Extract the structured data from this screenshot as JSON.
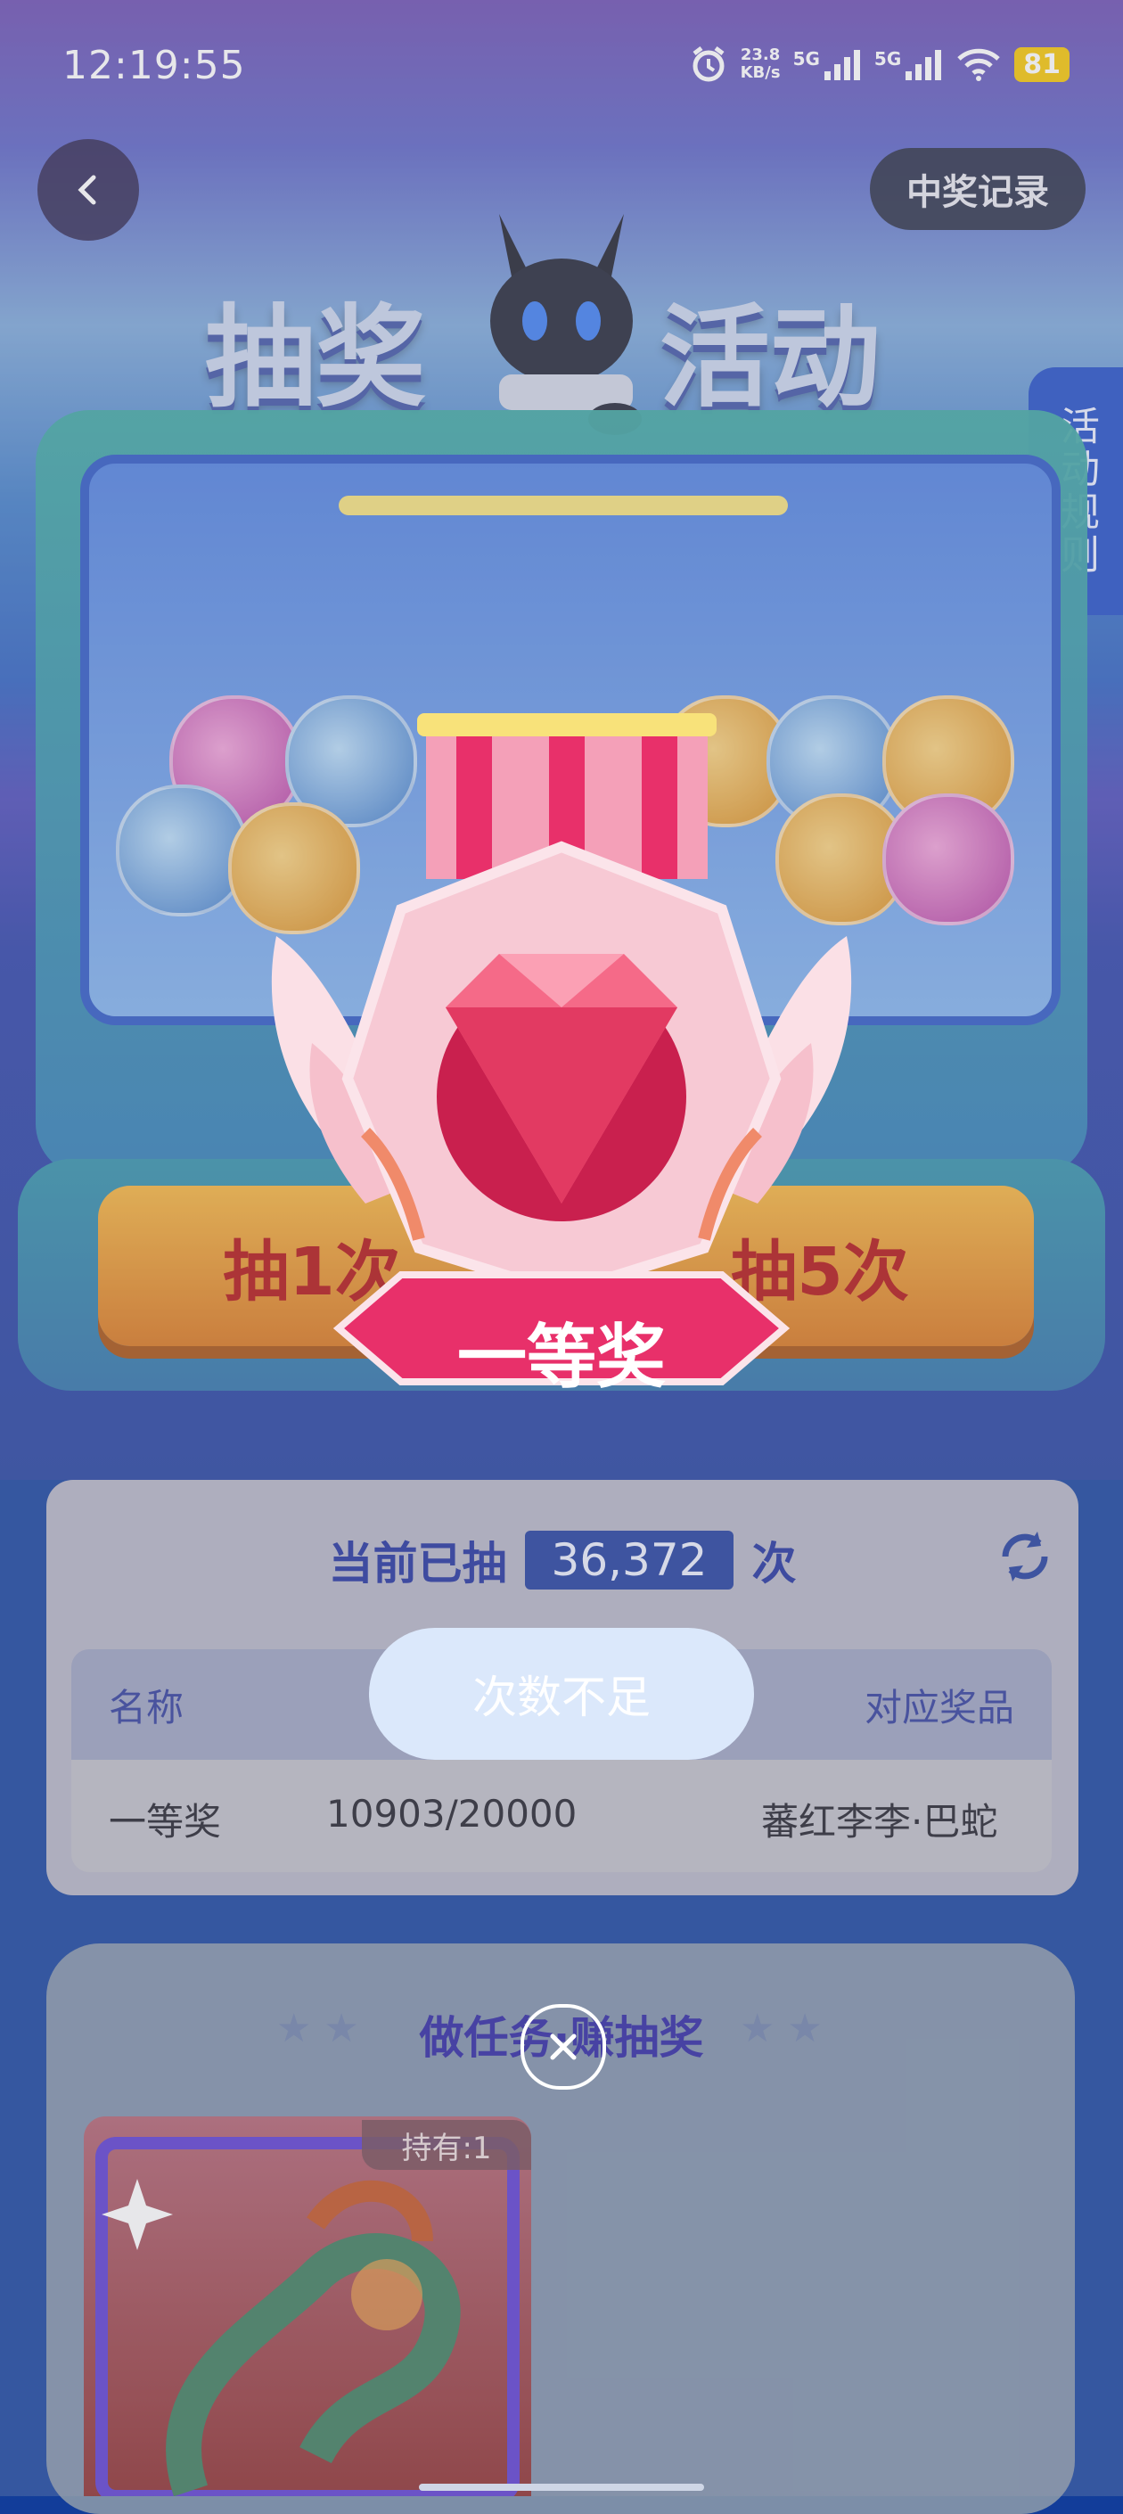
{
  "status_bar": {
    "time": "12:19:55",
    "net_speed": "23.8",
    "net_unit": "KB/s",
    "signal1": "5G",
    "signal2": "5G",
    "battery": "81"
  },
  "header": {
    "back_icon": "chevron-left-icon",
    "records_label": "中奖记录",
    "title_left": "抽奖",
    "title_right": "活动",
    "rules_label": "活动规则"
  },
  "machine": {
    "draw_once": "抽1次",
    "draw_five": "抽5次"
  },
  "prize_popup": {
    "prize_name": "一等奖",
    "close_icon": "close-icon"
  },
  "stats": {
    "prefix": "当前已抽",
    "count": "36,372",
    "suffix": "次",
    "refresh_icon": "refresh-icon"
  },
  "table": {
    "col_name": "名称",
    "col_prize": "对应奖品",
    "rows": [
      {
        "name": "一等奖",
        "progress": "10903/20000",
        "prize": "蕃红李李·巴蛇"
      }
    ]
  },
  "toast": "次数不足",
  "tasks": {
    "title": "做任务·赚抽奖",
    "card_hold": "持有:1"
  },
  "colors": {
    "accent": "#1e3b9c",
    "ribbon": "#e8306a",
    "gold": "#f4b23a"
  }
}
